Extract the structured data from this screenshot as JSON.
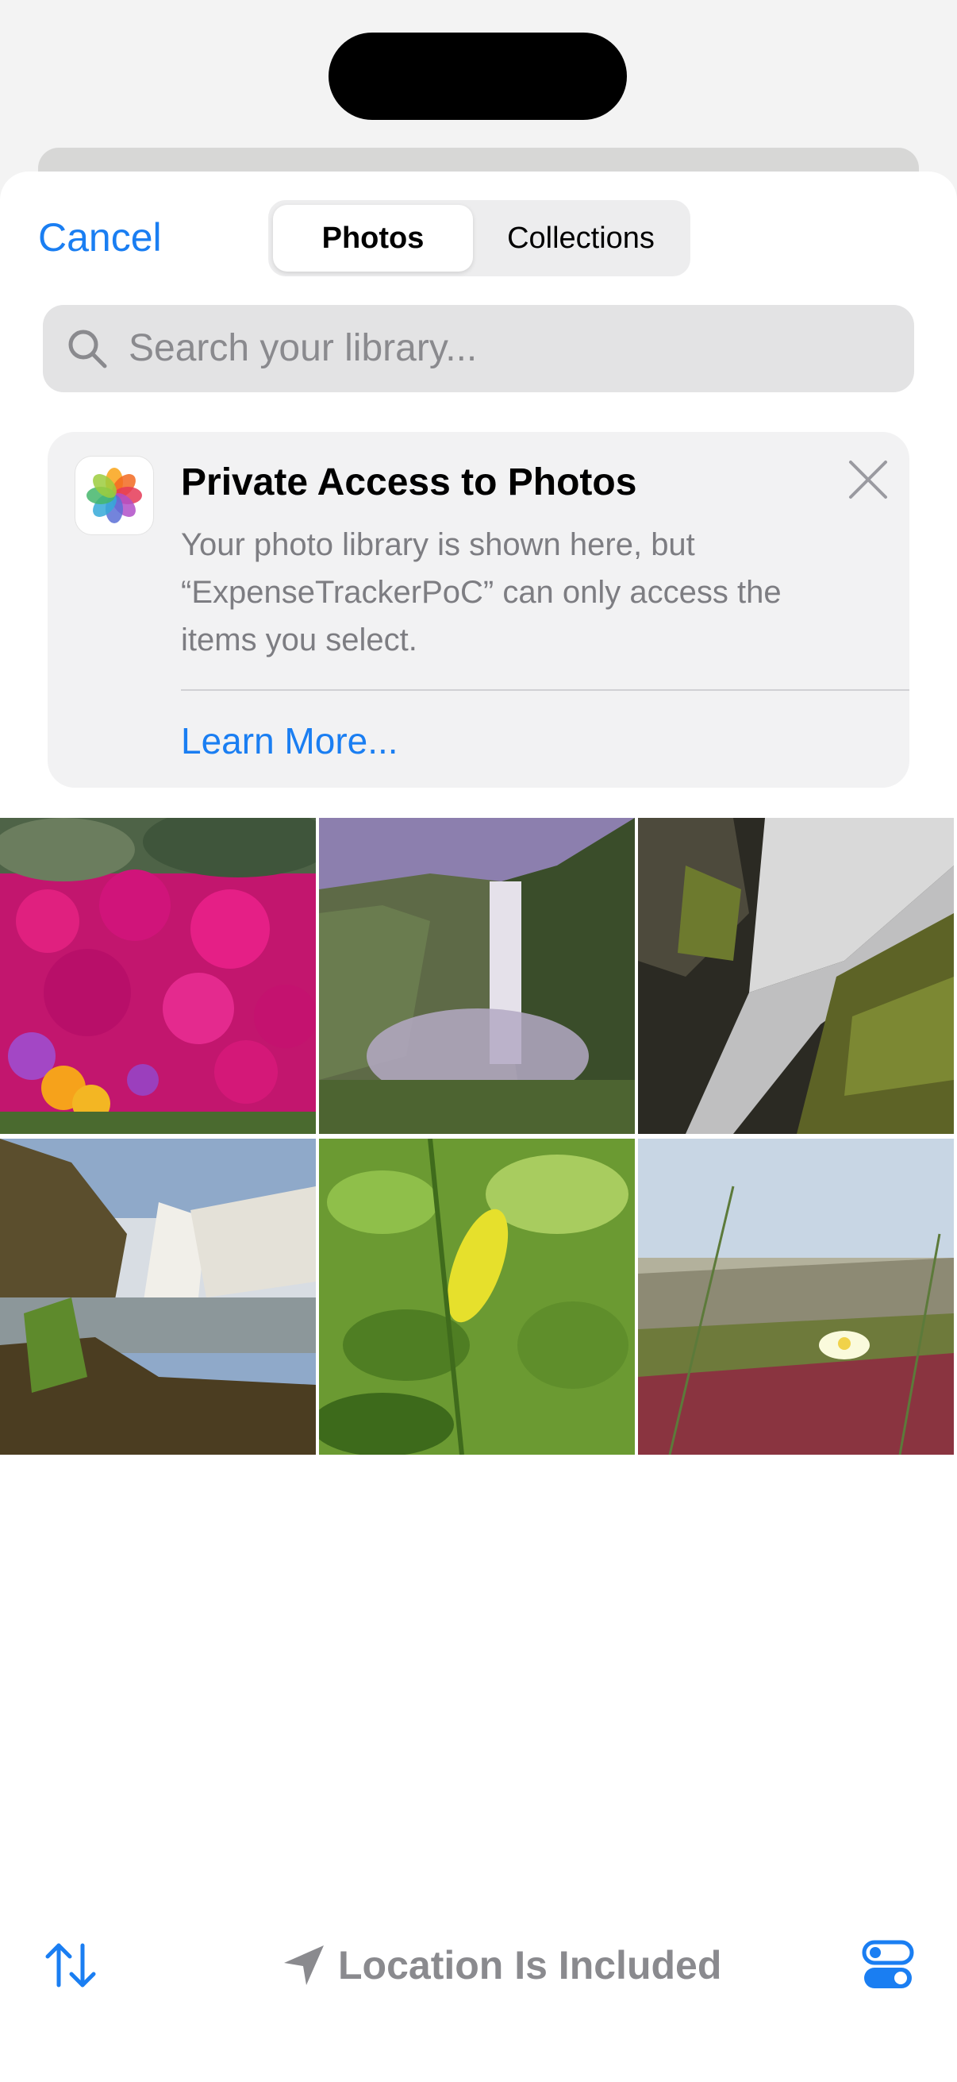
{
  "header": {
    "cancel_label": "Cancel",
    "segments": [
      {
        "label": "Photos",
        "selected": true
      },
      {
        "label": "Collections",
        "selected": false
      }
    ]
  },
  "search": {
    "placeholder": "Search your library..."
  },
  "notice": {
    "title": "Private Access to Photos",
    "body": "Your photo library is shown here, but “ExpenseTrackerPoC” can only access the items you select.",
    "link": "Learn More..."
  },
  "photos": [
    {
      "subject": "magenta-flowers"
    },
    {
      "subject": "waterfall-valley"
    },
    {
      "subject": "waterfall-rocks"
    },
    {
      "subject": "waterfall-cliff"
    },
    {
      "subject": "green-leaves"
    },
    {
      "subject": "coastal-flower"
    }
  ],
  "toolbar": {
    "location_label": "Location Is Included",
    "icons": [
      "sort-arrows-icon",
      "location-arrow-icon",
      "toggle-options-icon"
    ]
  },
  "colors": {
    "accent": "#1a7ef2",
    "secondary_text": "#8a8a8e"
  }
}
